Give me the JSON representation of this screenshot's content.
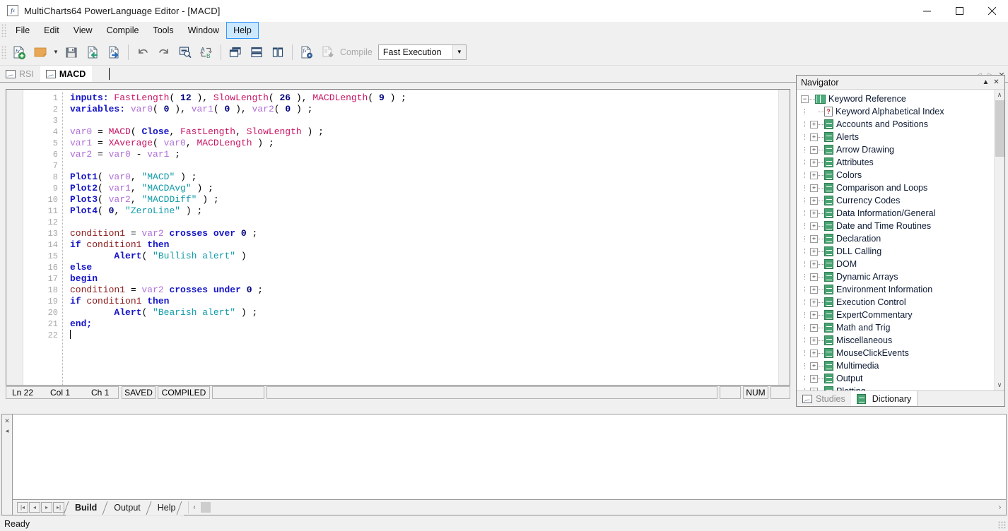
{
  "window": {
    "title": "MultiCharts64 PowerLanguage Editor - [MACD]",
    "app_icon": "fx-document-icon",
    "minimize": "—",
    "maximize": "□",
    "close": "✕"
  },
  "menubar": {
    "items": [
      {
        "label": "File",
        "active": false
      },
      {
        "label": "Edit",
        "active": false
      },
      {
        "label": "View",
        "active": false
      },
      {
        "label": "Compile",
        "active": false
      },
      {
        "label": "Tools",
        "active": false
      },
      {
        "label": "Window",
        "active": false
      },
      {
        "label": "Help",
        "active": true
      }
    ]
  },
  "toolbar": {
    "buttons": [
      {
        "name": "new-study-icon",
        "tip": "New Study"
      },
      {
        "name": "open-study-icon",
        "tip": "Open Study"
      },
      {
        "name": "open-dropdown-caret",
        "tip": "Open recent"
      },
      {
        "name": "save-icon",
        "tip": "Save"
      },
      {
        "name": "import-study-icon",
        "tip": "Import"
      },
      {
        "name": "export-study-icon",
        "tip": "Export"
      },
      {
        "name": "undo-icon",
        "tip": "Undo"
      },
      {
        "name": "redo-icon",
        "tip": "Redo"
      },
      {
        "name": "find-icon",
        "tip": "Find"
      },
      {
        "name": "replace-icon",
        "tip": "Replace"
      },
      {
        "name": "cascade-windows-icon",
        "tip": "Cascade"
      },
      {
        "name": "tile-horizontal-icon",
        "tip": "Tile Horizontally"
      },
      {
        "name": "tile-vertical-icon",
        "tip": "Tile Vertically"
      },
      {
        "name": "study-properties-icon",
        "tip": "Properties"
      },
      {
        "name": "compile-icon",
        "tip": "Compile"
      }
    ],
    "compile_label": "Compile",
    "compile_mode": "Fast Execution",
    "compile_mode_caret": "▼"
  },
  "document_tabs": {
    "tabs": [
      {
        "label": "RSI",
        "active": false,
        "icon": "study-icon"
      },
      {
        "label": "MACD",
        "active": true,
        "icon": "study-icon"
      }
    ],
    "tools": [
      {
        "name": "tab-prev-icon",
        "glyph": "◁"
      },
      {
        "name": "tab-next-icon",
        "glyph": "▷"
      },
      {
        "name": "tab-close-icon",
        "glyph": "✕"
      }
    ]
  },
  "editor": {
    "line_numbers": [
      "1",
      "2",
      "3",
      "4",
      "5",
      "6",
      "7",
      "8",
      "9",
      "10",
      "11",
      "12",
      "13",
      "14",
      "15",
      "16",
      "17",
      "18",
      "19",
      "20",
      "21",
      "22"
    ],
    "lines": [
      {
        "n": 1,
        "tokens": [
          {
            "t": "inputs:",
            "c": "k"
          },
          {
            "t": " ",
            "c": "op"
          },
          {
            "t": "FastLength",
            "c": "fn"
          },
          {
            "t": "( ",
            "c": "op"
          },
          {
            "t": "12",
            "c": "n"
          },
          {
            "t": " ), ",
            "c": "op"
          },
          {
            "t": "SlowLength",
            "c": "fn"
          },
          {
            "t": "( ",
            "c": "op"
          },
          {
            "t": "26",
            "c": "n"
          },
          {
            "t": " ), ",
            "c": "op"
          },
          {
            "t": "MACDLength",
            "c": "fn"
          },
          {
            "t": "( ",
            "c": "op"
          },
          {
            "t": "9",
            "c": "n"
          },
          {
            "t": " ) ;",
            "c": "op"
          }
        ]
      },
      {
        "n": 2,
        "tokens": [
          {
            "t": "variables:",
            "c": "k"
          },
          {
            "t": " ",
            "c": "op"
          },
          {
            "t": "var0",
            "c": "v"
          },
          {
            "t": "( ",
            "c": "op"
          },
          {
            "t": "0",
            "c": "n"
          },
          {
            "t": " ), ",
            "c": "op"
          },
          {
            "t": "var1",
            "c": "v"
          },
          {
            "t": "( ",
            "c": "op"
          },
          {
            "t": "0",
            "c": "n"
          },
          {
            "t": " ), ",
            "c": "op"
          },
          {
            "t": "var2",
            "c": "v"
          },
          {
            "t": "( ",
            "c": "op"
          },
          {
            "t": "0",
            "c": "n"
          },
          {
            "t": " ) ;",
            "c": "op"
          }
        ]
      },
      {
        "n": 3,
        "tokens": []
      },
      {
        "n": 4,
        "tokens": [
          {
            "t": "var0",
            "c": "v"
          },
          {
            "t": " = ",
            "c": "op"
          },
          {
            "t": "MACD",
            "c": "fn"
          },
          {
            "t": "( ",
            "c": "op"
          },
          {
            "t": "Close",
            "c": "k"
          },
          {
            "t": ", ",
            "c": "op"
          },
          {
            "t": "FastLength",
            "c": "fn"
          },
          {
            "t": ", ",
            "c": "op"
          },
          {
            "t": "SlowLength",
            "c": "fn"
          },
          {
            "t": " ) ;",
            "c": "op"
          }
        ]
      },
      {
        "n": 5,
        "tokens": [
          {
            "t": "var1",
            "c": "v"
          },
          {
            "t": " = ",
            "c": "op"
          },
          {
            "t": "XAverage",
            "c": "fn"
          },
          {
            "t": "( ",
            "c": "op"
          },
          {
            "t": "var0",
            "c": "v"
          },
          {
            "t": ", ",
            "c": "op"
          },
          {
            "t": "MACDLength",
            "c": "fn"
          },
          {
            "t": " ) ;",
            "c": "op"
          }
        ]
      },
      {
        "n": 6,
        "tokens": [
          {
            "t": "var2",
            "c": "v"
          },
          {
            "t": " = ",
            "c": "op"
          },
          {
            "t": "var0",
            "c": "v"
          },
          {
            "t": " - ",
            "c": "op"
          },
          {
            "t": "var1",
            "c": "v"
          },
          {
            "t": " ;",
            "c": "op"
          }
        ]
      },
      {
        "n": 7,
        "tokens": []
      },
      {
        "n": 8,
        "tokens": [
          {
            "t": "Plot1",
            "c": "k"
          },
          {
            "t": "( ",
            "c": "op"
          },
          {
            "t": "var0",
            "c": "v"
          },
          {
            "t": ", ",
            "c": "op"
          },
          {
            "t": "\"MACD\"",
            "c": "s"
          },
          {
            "t": " ) ;",
            "c": "op"
          }
        ]
      },
      {
        "n": 9,
        "tokens": [
          {
            "t": "Plot2",
            "c": "k"
          },
          {
            "t": "( ",
            "c": "op"
          },
          {
            "t": "var1",
            "c": "v"
          },
          {
            "t": ", ",
            "c": "op"
          },
          {
            "t": "\"MACDAvg\"",
            "c": "s"
          },
          {
            "t": " ) ;",
            "c": "op"
          }
        ]
      },
      {
        "n": 10,
        "tokens": [
          {
            "t": "Plot3",
            "c": "k"
          },
          {
            "t": "( ",
            "c": "op"
          },
          {
            "t": "var2",
            "c": "v"
          },
          {
            "t": ", ",
            "c": "op"
          },
          {
            "t": "\"MACDDiff\"",
            "c": "s"
          },
          {
            "t": " ) ;",
            "c": "op"
          }
        ]
      },
      {
        "n": 11,
        "tokens": [
          {
            "t": "Plot4",
            "c": "k"
          },
          {
            "t": "( ",
            "c": "op"
          },
          {
            "t": "0",
            "c": "n"
          },
          {
            "t": ", ",
            "c": "op"
          },
          {
            "t": "\"ZeroLine\"",
            "c": "s"
          },
          {
            "t": " ) ;",
            "c": "op"
          }
        ]
      },
      {
        "n": 12,
        "tokens": []
      },
      {
        "n": 13,
        "tokens": [
          {
            "t": "condition1",
            "c": "c1"
          },
          {
            "t": " = ",
            "c": "op"
          },
          {
            "t": "var2",
            "c": "v"
          },
          {
            "t": " ",
            "c": "op"
          },
          {
            "t": "crosses over",
            "c": "k"
          },
          {
            "t": " ",
            "c": "op"
          },
          {
            "t": "0",
            "c": "n"
          },
          {
            "t": " ;",
            "c": "op"
          }
        ]
      },
      {
        "n": 14,
        "tokens": [
          {
            "t": "if",
            "c": "k"
          },
          {
            "t": " ",
            "c": "op"
          },
          {
            "t": "condition1",
            "c": "c1"
          },
          {
            "t": " ",
            "c": "op"
          },
          {
            "t": "then",
            "c": "k"
          }
        ]
      },
      {
        "n": 15,
        "tokens": [
          {
            "t": "        ",
            "c": "op"
          },
          {
            "t": "Alert",
            "c": "k"
          },
          {
            "t": "( ",
            "c": "op"
          },
          {
            "t": "\"Bullish alert\"",
            "c": "s"
          },
          {
            "t": " )",
            "c": "op"
          }
        ]
      },
      {
        "n": 16,
        "tokens": [
          {
            "t": "else",
            "c": "k"
          }
        ]
      },
      {
        "n": 17,
        "tokens": [
          {
            "t": "begin",
            "c": "k"
          }
        ]
      },
      {
        "n": 18,
        "tokens": [
          {
            "t": "condition1",
            "c": "c1"
          },
          {
            "t": " = ",
            "c": "op"
          },
          {
            "t": "var2",
            "c": "v"
          },
          {
            "t": " ",
            "c": "op"
          },
          {
            "t": "crosses under",
            "c": "k"
          },
          {
            "t": " ",
            "c": "op"
          },
          {
            "t": "0",
            "c": "n"
          },
          {
            "t": " ;",
            "c": "op"
          }
        ]
      },
      {
        "n": 19,
        "tokens": [
          {
            "t": "if",
            "c": "k"
          },
          {
            "t": " ",
            "c": "op"
          },
          {
            "t": "condition1",
            "c": "c1"
          },
          {
            "t": " ",
            "c": "op"
          },
          {
            "t": "then",
            "c": "k"
          }
        ]
      },
      {
        "n": 20,
        "tokens": [
          {
            "t": "        ",
            "c": "op"
          },
          {
            "t": "Alert",
            "c": "k"
          },
          {
            "t": "( ",
            "c": "op"
          },
          {
            "t": "\"Bearish alert\"",
            "c": "s"
          },
          {
            "t": " ) ;",
            "c": "op"
          }
        ]
      },
      {
        "n": 21,
        "tokens": [
          {
            "t": "end;",
            "c": "k"
          }
        ]
      },
      {
        "n": 22,
        "tokens": [],
        "caret": true
      }
    ]
  },
  "editor_status": {
    "line": "Ln 22",
    "column": "Col 1",
    "char": "Ch 1",
    "saved": "SAVED",
    "compiled": "COMPILED",
    "num_lock": "NUM"
  },
  "navigator": {
    "title": "Navigator",
    "collapse_glyph": "▲",
    "close_glyph": "✕",
    "root": {
      "label": "Keyword Reference",
      "expander": "−",
      "icon": "book-icon"
    },
    "items": [
      {
        "label": "Keyword Alphabetical Index",
        "icon": "question-doc-icon",
        "expander": null
      },
      {
        "label": "Accounts and Positions",
        "icon": "doc-icon",
        "expander": "+"
      },
      {
        "label": "Alerts",
        "icon": "doc-icon",
        "expander": "+"
      },
      {
        "label": "Arrow Drawing",
        "icon": "doc-icon",
        "expander": "+"
      },
      {
        "label": "Attributes",
        "icon": "doc-icon",
        "expander": "+"
      },
      {
        "label": "Colors",
        "icon": "doc-icon",
        "expander": "+"
      },
      {
        "label": "Comparison and Loops",
        "icon": "doc-icon",
        "expander": "+"
      },
      {
        "label": "Currency Codes",
        "icon": "doc-icon",
        "expander": "+"
      },
      {
        "label": "Data Information/General",
        "icon": "doc-icon",
        "expander": "+"
      },
      {
        "label": "Date and Time Routines",
        "icon": "doc-icon",
        "expander": "+"
      },
      {
        "label": "Declaration",
        "icon": "doc-icon",
        "expander": "+"
      },
      {
        "label": "DLL Calling",
        "icon": "doc-icon",
        "expander": "+"
      },
      {
        "label": "DOM",
        "icon": "doc-icon",
        "expander": "+"
      },
      {
        "label": "Dynamic Arrays",
        "icon": "doc-icon",
        "expander": "+"
      },
      {
        "label": "Environment Information",
        "icon": "doc-icon",
        "expander": "+"
      },
      {
        "label": "Execution Control",
        "icon": "doc-icon",
        "expander": "+"
      },
      {
        "label": "ExpertCommentary",
        "icon": "doc-icon",
        "expander": "+"
      },
      {
        "label": "Math and Trig",
        "icon": "doc-icon",
        "expander": "+"
      },
      {
        "label": "Miscellaneous",
        "icon": "doc-icon",
        "expander": "+"
      },
      {
        "label": "MouseClickEvents",
        "icon": "doc-icon",
        "expander": "+"
      },
      {
        "label": "Multimedia",
        "icon": "doc-icon",
        "expander": "+"
      },
      {
        "label": "Output",
        "icon": "doc-icon",
        "expander": "+"
      },
      {
        "label": "Plotting",
        "icon": "doc-icon",
        "expander": "+"
      }
    ],
    "scroll_up": "∧",
    "scroll_down": "∨",
    "tabs": [
      {
        "label": "Studies",
        "active": false,
        "icon": "study-icon"
      },
      {
        "label": "Dictionary",
        "active": true,
        "icon": "doc-icon"
      }
    ]
  },
  "bottom_pane": {
    "rail": [
      {
        "name": "pane-close-icon",
        "glyph": "✕"
      },
      {
        "name": "pane-collapse-icon",
        "glyph": "◂"
      }
    ],
    "content": "",
    "nav_buttons": [
      {
        "name": "first-tab-icon",
        "glyph": "|◂"
      },
      {
        "name": "prev-tab-icon",
        "glyph": "◂"
      },
      {
        "name": "next-tab-icon",
        "glyph": "▸"
      },
      {
        "name": "last-tab-icon",
        "glyph": "▸|"
      }
    ],
    "tabs": [
      {
        "label": "Build",
        "active": true
      },
      {
        "label": "Output",
        "active": false
      },
      {
        "label": "Help",
        "active": false
      }
    ],
    "scroll_left": "‹",
    "scroll_right": "›"
  },
  "app_status": {
    "text": "Ready"
  }
}
